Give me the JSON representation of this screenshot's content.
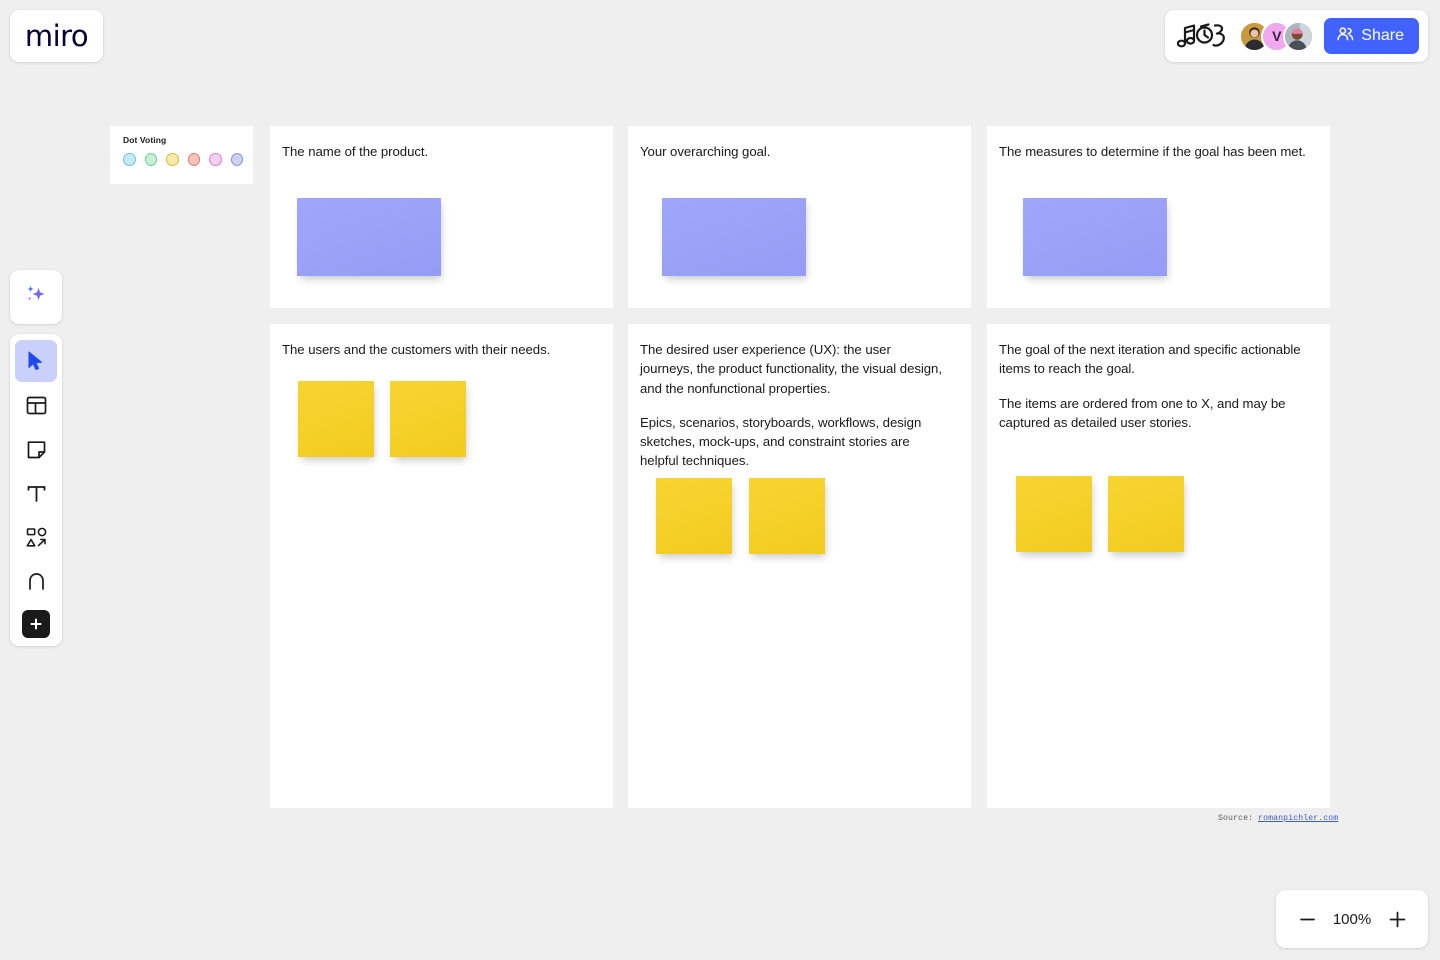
{
  "app": {
    "logo_text": "miro",
    "background_color": "#efefef",
    "accent_color": "#4262ff"
  },
  "topbar": {
    "doodle_icon": "music-doodle-icon",
    "collaborators": [
      {
        "name": "collaborator-1",
        "initial": "",
        "color": "#c79a3f",
        "type": "photo"
      },
      {
        "name": "collaborator-2",
        "initial": "V",
        "color": "#f0a8ef",
        "type": "initial"
      },
      {
        "name": "collaborator-3",
        "initial": "",
        "color": "#8fa0ad",
        "type": "photo"
      }
    ],
    "share_label": "Share",
    "share_icon": "people-icon"
  },
  "toolbar": {
    "ai_tool": {
      "name": "ai-sparkles-icon",
      "label": "AI"
    },
    "tools": [
      {
        "name": "cursor-icon",
        "label": "Select",
        "active": true
      },
      {
        "name": "template-frame-icon",
        "label": "Templates",
        "active": false
      },
      {
        "name": "sticky-note-icon",
        "label": "Sticky note",
        "active": false
      },
      {
        "name": "text-icon",
        "label": "Text",
        "active": false
      },
      {
        "name": "shapes-icon",
        "label": "Shapes and connection lines",
        "active": false
      },
      {
        "name": "pen-icon",
        "label": "Pen",
        "active": false
      }
    ],
    "more_label": "+"
  },
  "dot_voting": {
    "title": "Dot Voting",
    "colors": [
      "#a8daf0",
      "#9fe3b6",
      "#f5dd6b",
      "#f2907f",
      "#eba6ec",
      "#a3a6e8"
    ]
  },
  "cards": [
    {
      "id": "card-name",
      "name": "card-product-name",
      "paragraphs": [
        "The name of the product."
      ],
      "notes": [
        {
          "color": "purple",
          "shape": "wide"
        }
      ]
    },
    {
      "id": "card-goal",
      "name": "card-overarching-goal",
      "paragraphs": [
        "Your overarching goal."
      ],
      "notes": [
        {
          "color": "purple",
          "shape": "wide"
        }
      ]
    },
    {
      "id": "card-measures",
      "name": "card-measures",
      "paragraphs": [
        "The measures to determine if the goal has been met."
      ],
      "notes": [
        {
          "color": "purple",
          "shape": "wide"
        }
      ]
    },
    {
      "id": "card-users",
      "name": "card-users-customers",
      "paragraphs": [
        "The users and the customers with their needs."
      ],
      "notes": [
        {
          "color": "yellow",
          "shape": "square"
        },
        {
          "color": "yellow",
          "shape": "square"
        }
      ]
    },
    {
      "id": "card-ux",
      "name": "card-user-experience",
      "paragraphs": [
        "The desired user experience (UX): the user journeys, the product functionality, the visual design, and the nonfunctional properties.",
        "Epics, scenarios, storyboards, workflows, design sketches, mock-ups, and constraint stories are helpful techniques."
      ],
      "notes": [
        {
          "color": "yellow",
          "shape": "square"
        },
        {
          "color": "yellow",
          "shape": "square"
        }
      ]
    },
    {
      "id": "card-iteration",
      "name": "card-next-iteration",
      "paragraphs": [
        "The goal of the next iteration and specific actionable items to reach the goal.",
        "The items are ordered from one to X, and may be captured as detailed user stories."
      ],
      "notes": [
        {
          "color": "yellow",
          "shape": "square"
        },
        {
          "color": "yellow",
          "shape": "square"
        }
      ]
    }
  ],
  "source": {
    "prefix": "Source: ",
    "link_text": "romanpichler.com"
  },
  "zoom": {
    "minus_label": "−",
    "level": "100%",
    "plus_label": "+"
  },
  "sticky_colors": {
    "purple": "#9ba2f7",
    "yellow": "#f5d12a"
  }
}
